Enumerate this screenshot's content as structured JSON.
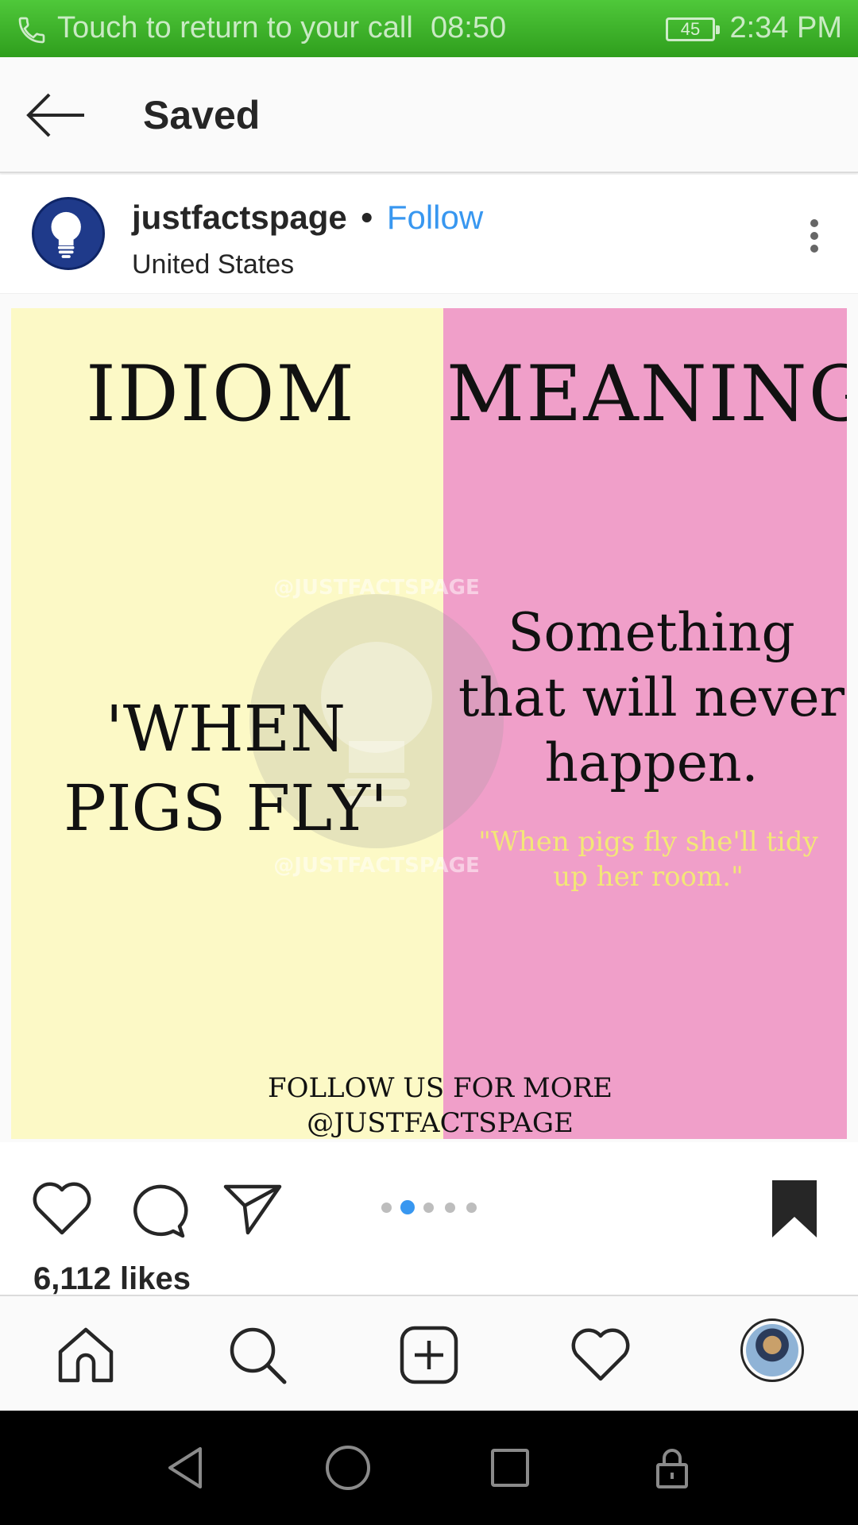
{
  "status_bar": {
    "call_text": "Touch to return to your call",
    "call_timer": "08:50",
    "battery": "45",
    "time": "2:34 PM"
  },
  "header": {
    "title": "Saved",
    "back_icon": "arrow-left-icon"
  },
  "post": {
    "username": "justfactspage",
    "separator": "•",
    "follow_label": "Follow",
    "location": "United States",
    "more_icon": "more-vertical-icon",
    "image": {
      "idiom_heading": "IDIOM",
      "meaning_heading": "MEANING",
      "idiom_line1": "'WHEN",
      "idiom_line2": "PIGS FLY'",
      "meaning_line1": "Something",
      "meaning_line2": "that will never",
      "meaning_line3": "happen.",
      "example_line1": "\"When pigs fly she'll tidy",
      "example_line2": "up her room.\"",
      "footer_line1": "FOLLOW US FOR MORE",
      "footer_line2": "@JUSTFACTSPAGE",
      "watermark": "@JUSTFACTSPAGE",
      "left_color": "#fcf9c6",
      "right_color": "#f09fc9"
    },
    "carousel": {
      "total": 5,
      "active_index": 1
    },
    "likes": "6,112 likes"
  },
  "colors": {
    "accent": "#3897f0",
    "status_bar": "#3fb52a"
  },
  "tab_bar": {
    "items": [
      "home-icon",
      "search-icon",
      "new-post-icon",
      "heart-icon",
      "profile-avatar"
    ]
  },
  "nav_bar": {
    "items": [
      "back-triangle-icon",
      "home-circle-icon",
      "recents-square-icon",
      "lock-icon"
    ]
  }
}
